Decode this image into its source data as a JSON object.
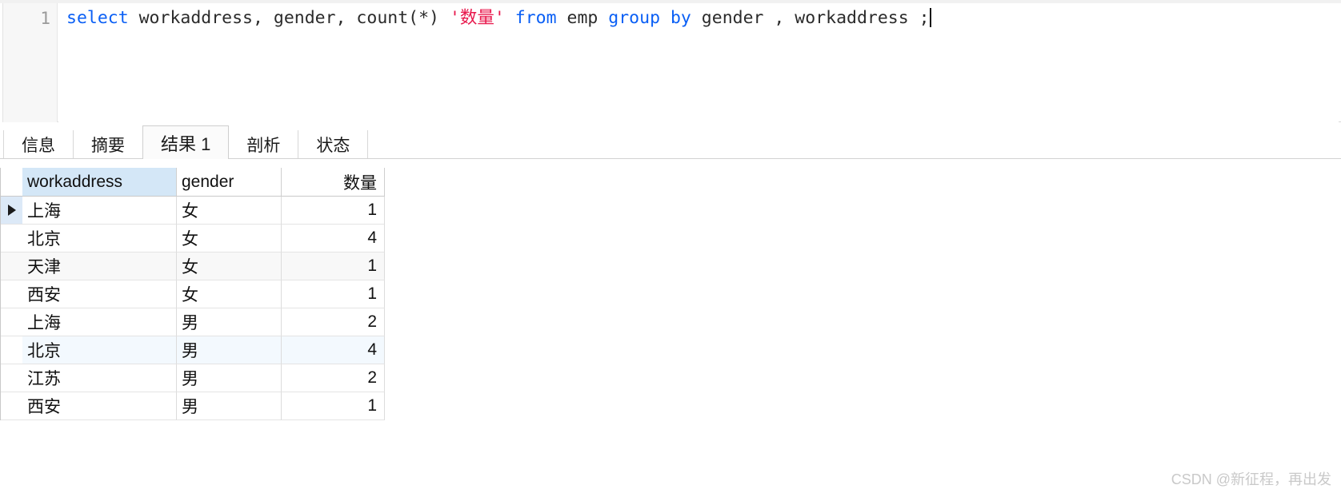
{
  "editor": {
    "line_number": "1",
    "sql_tokens": [
      {
        "text": "select ",
        "type": "keyword"
      },
      {
        "text": "workaddress, gender, count(*) ",
        "type": "plain"
      },
      {
        "text": "'数量'",
        "type": "string"
      },
      {
        "text": " ",
        "type": "plain"
      },
      {
        "text": "from",
        "type": "keyword"
      },
      {
        "text": " emp ",
        "type": "plain"
      },
      {
        "text": "group by",
        "type": "keyword"
      },
      {
        "text": " gender , workaddress ;",
        "type": "plain"
      }
    ],
    "sql_full": "select workaddress, gender, count(*) '数量' from emp group by gender , workaddress ;",
    "caret_visible": true
  },
  "tabs": [
    {
      "label": "信息",
      "active": false
    },
    {
      "label": "摘要",
      "active": false
    },
    {
      "label": "结果 1",
      "active": true
    },
    {
      "label": "剖析",
      "active": false
    },
    {
      "label": "状态",
      "active": false
    }
  ],
  "results": {
    "columns": [
      "workaddress",
      "gender",
      "数量"
    ],
    "selected_column": "workaddress",
    "current_row_index": 0,
    "rows": [
      {
        "workaddress": "上海",
        "gender": "女",
        "数量": "1"
      },
      {
        "workaddress": "北京",
        "gender": "女",
        "数量": "4"
      },
      {
        "workaddress": "天津",
        "gender": "女",
        "数量": "1"
      },
      {
        "workaddress": "西安",
        "gender": "女",
        "数量": "1"
      },
      {
        "workaddress": "上海",
        "gender": "男",
        "数量": "2"
      },
      {
        "workaddress": "北京",
        "gender": "男",
        "数量": "4"
      },
      {
        "workaddress": "江苏",
        "gender": "男",
        "数量": "2"
      },
      {
        "workaddress": "西安",
        "gender": "男",
        "数量": "1"
      }
    ]
  },
  "watermark": {
    "text": "CSDN @新征程，再出发"
  },
  "colors": {
    "keyword": "#0a5ff5",
    "string": "#e8184c",
    "header_selected": "#d4e7f7",
    "row_alt": "#f8f8f8",
    "row_selected": "#f3f9fe"
  }
}
